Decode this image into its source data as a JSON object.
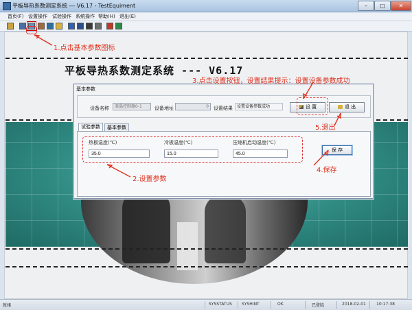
{
  "window": {
    "title": "平板导热系数测定系统 --- V6.17 - TestEquiment",
    "min": "–",
    "max": "□",
    "close": "✕"
  },
  "menu": [
    "首页(F)",
    "设置操作",
    "试验操作",
    "系统操作",
    "帮助(H)",
    "退出(E)"
  ],
  "toolbar_icons": [
    "folder-icon",
    "network-icon",
    "basic-params-icon",
    "image-icon",
    "report-icon",
    "scan-icon",
    "book-icon",
    "save-icon",
    "grid-icon",
    "print-icon",
    "exit-icon",
    "export-icon"
  ],
  "main": {
    "system_title": "平板导热系数测定系统  ---  V6.17"
  },
  "dialog": {
    "title": "基本参数",
    "device_name_label": "设备名称",
    "device_name_value": "液晶控制器0-1",
    "device_addr_label": "设备地址",
    "device_addr_value": "0",
    "result_label": "设置结果",
    "result_value": "设置设备参数成功",
    "set_button": "设 置",
    "exit_button": "退 出",
    "tabs": [
      "试验参数",
      "基本参数"
    ],
    "hot_plate_label": "热板温度(℃)",
    "hot_plate_value": "35.0",
    "cold_plate_label": "冷板温度(℃)",
    "cold_plate_value": "15.0",
    "compressor_label": "压缩机启动温度(℃)",
    "compressor_value": "45.0",
    "save_button": "保 存"
  },
  "annotations": {
    "step1": "1.点击基本参数图标",
    "step2": "2.设置参数",
    "step3": "3.点击设置按钮，设置结果提示：设置设备参数成功",
    "step4": "4.保存",
    "step5": "5.退出"
  },
  "statusbar": {
    "left": "就绪",
    "sysstatus": "SYSSTATUS",
    "syshint": "SYSHINT",
    "ok": "OK",
    "logged": "已登陆",
    "date": "2018-02-01",
    "time": "10:17:38"
  },
  "colors": {
    "annotation": "#e0321e",
    "teal": "#2f8a82"
  }
}
